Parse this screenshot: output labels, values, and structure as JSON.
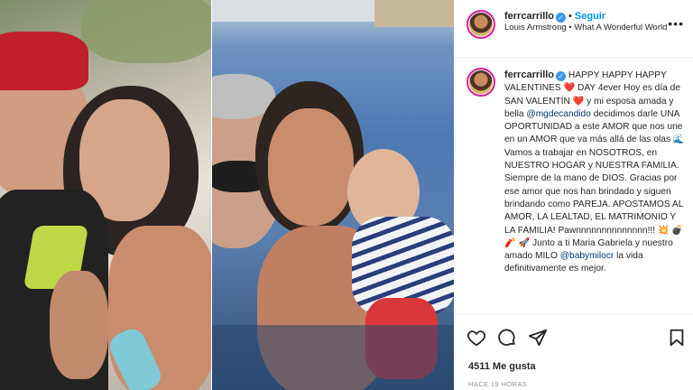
{
  "post": {
    "username": "ferrcarrillo",
    "verified_icon": "verified-badge-icon",
    "follow_label": "Seguir",
    "separator": "•",
    "music": "Louis Armstrong • What A Wonderful World",
    "more_icon": "more-options-icon",
    "more_label": "•••"
  },
  "caption": {
    "username": "ferrcarrillo",
    "part1": "HAPPY HAPPY HAPPY VALENTINES ❤️ DAY 4ever Hoy es día de SAN VALENTÍN ❤️ y mi esposa amada y bella ",
    "mention1": "@mgdecandido",
    "part2": " decidimos darle UNA OPORTUNIDAD a este AMOR que nos une en un AMOR que va más allá de las olas 🌊 Vamos a trabajar en NOSOTROS, en NUESTRO HOGAR y NUESTRA FAMILIA. Siempre de la mano de DIOS. Gracias por ese amor que nos han brindado y siguen brindando como PAREJA. APOSTAMOS AL AMOR, LA LEALTAD, EL MATRIMONIO Y LA FAMILIA! Pawnnnnnnnnnnnnnn!!! 💥 💣 🧨 🚀 Junto a ti Maria Gabriela y nuestro amado MILO ",
    "mention2": "@babymilocr",
    "part3": " la vida definitivamente es mejor."
  },
  "actions": {
    "like_icon": "heart-icon",
    "comment_icon": "comment-icon",
    "share_icon": "share-icon",
    "save_icon": "bookmark-icon",
    "likes": "4511 Me gusta",
    "time": "HACE 19 HORAS"
  },
  "colors": {
    "accent": "#0095f6",
    "verified": "#3897f0",
    "mention": "#00376b",
    "muted": "#8e8e8e"
  }
}
